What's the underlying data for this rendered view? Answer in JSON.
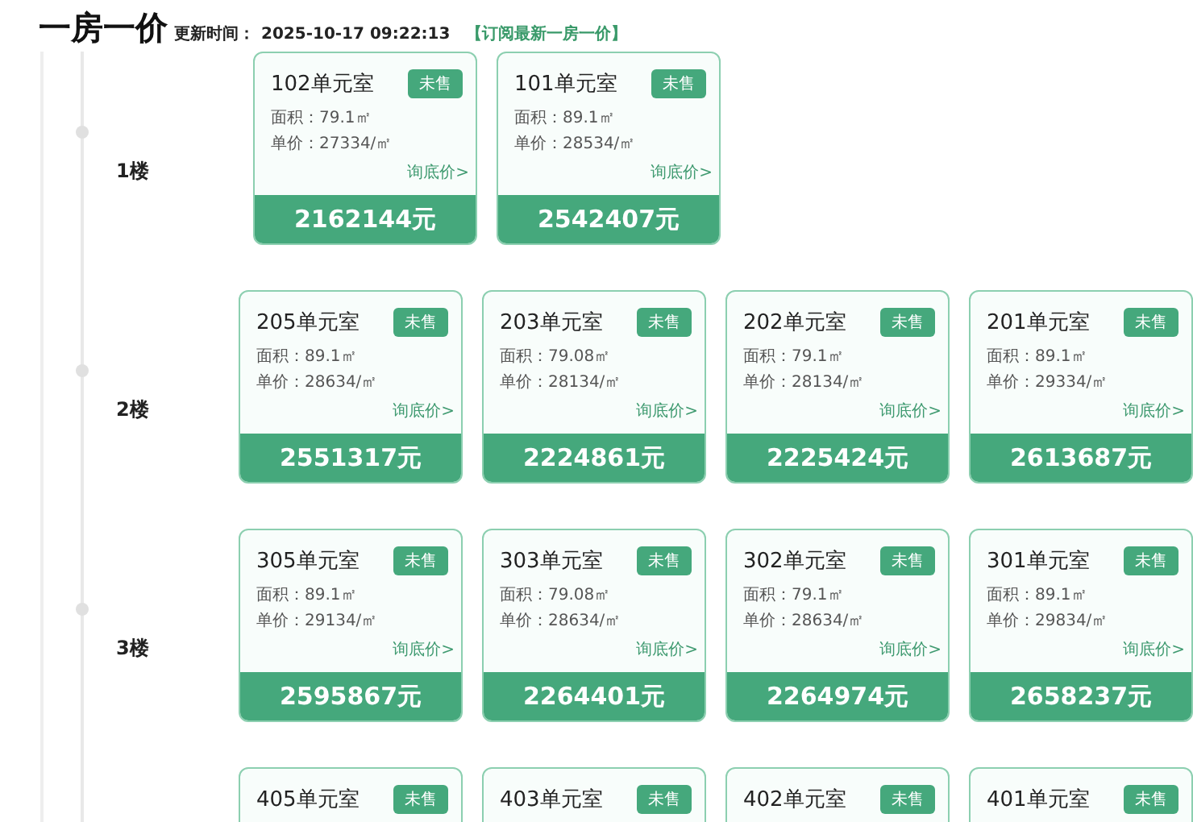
{
  "header": {
    "title": "一房一价",
    "updated_label": "更新时间：",
    "updated_time": "2025-10-17 09:22:13",
    "subscribe_link": "【订阅最新一房一价】"
  },
  "floors": [
    {
      "label": "1楼",
      "units": [
        {
          "name": "102单元室",
          "status": "未售",
          "area": "面积：79.1㎡",
          "unit_price": "单价：27334/㎡",
          "inquiry": "询底价>",
          "total": "2162144元"
        },
        {
          "name": "101单元室",
          "status": "未售",
          "area": "面积：89.1㎡",
          "unit_price": "单价：28534/㎡",
          "inquiry": "询底价>",
          "total": "2542407元"
        }
      ]
    },
    {
      "label": "2楼",
      "units": [
        {
          "name": "205单元室",
          "status": "未售",
          "area": "面积：89.1㎡",
          "unit_price": "单价：28634/㎡",
          "inquiry": "询底价>",
          "total": "2551317元"
        },
        {
          "name": "203单元室",
          "status": "未售",
          "area": "面积：79.08㎡",
          "unit_price": "单价：28134/㎡",
          "inquiry": "询底价>",
          "total": "2224861元"
        },
        {
          "name": "202单元室",
          "status": "未售",
          "area": "面积：79.1㎡",
          "unit_price": "单价：28134/㎡",
          "inquiry": "询底价>",
          "total": "2225424元"
        },
        {
          "name": "201单元室",
          "status": "未售",
          "area": "面积：89.1㎡",
          "unit_price": "单价：29334/㎡",
          "inquiry": "询底价>",
          "total": "2613687元"
        }
      ]
    },
    {
      "label": "3楼",
      "units": [
        {
          "name": "305单元室",
          "status": "未售",
          "area": "面积：89.1㎡",
          "unit_price": "单价：29134/㎡",
          "inquiry": "询底价>",
          "total": "2595867元"
        },
        {
          "name": "303单元室",
          "status": "未售",
          "area": "面积：79.08㎡",
          "unit_price": "单价：28634/㎡",
          "inquiry": "询底价>",
          "total": "2264401元"
        },
        {
          "name": "302单元室",
          "status": "未售",
          "area": "面积：79.1㎡",
          "unit_price": "单价：28634/㎡",
          "inquiry": "询底价>",
          "total": "2264974元"
        },
        {
          "name": "301单元室",
          "status": "未售",
          "area": "面积：89.1㎡",
          "unit_price": "单价：29834/㎡",
          "inquiry": "询底价>",
          "total": "2658237元"
        }
      ]
    },
    {
      "units": [
        {
          "name": "405单元室",
          "status": "未售"
        },
        {
          "name": "403单元室",
          "status": "未售"
        },
        {
          "name": "402单元室",
          "status": "未售"
        },
        {
          "name": "401单元室",
          "status": "未售"
        }
      ]
    }
  ]
}
